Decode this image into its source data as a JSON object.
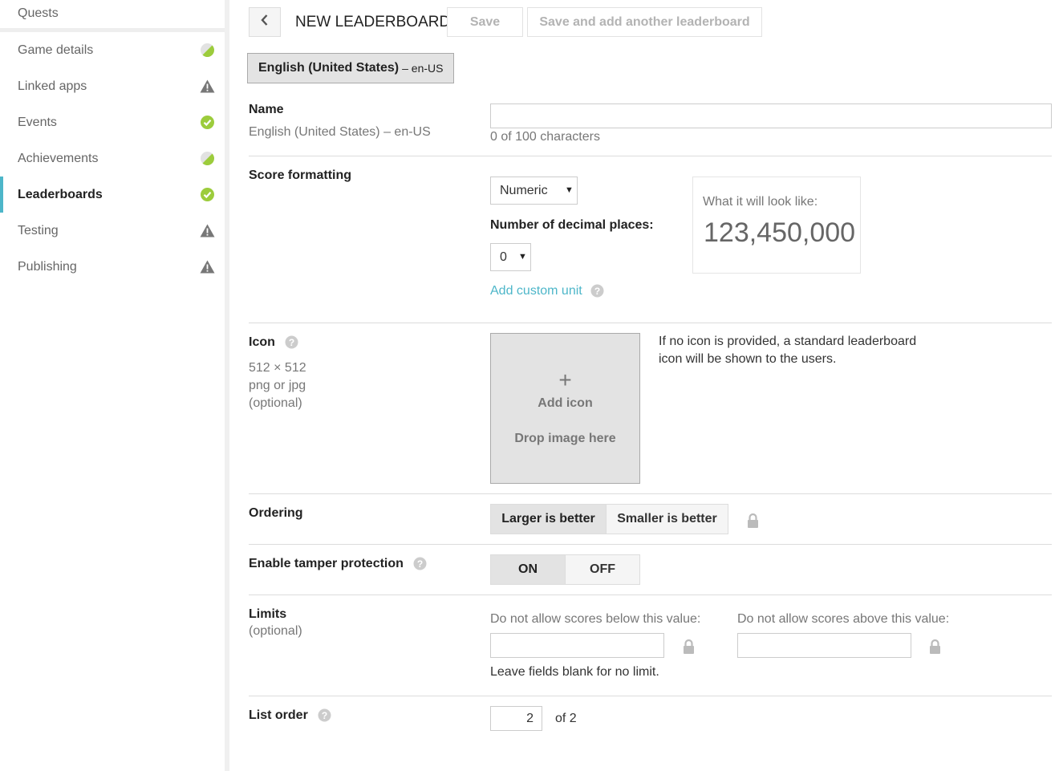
{
  "sidebar": {
    "top_item": "Quests",
    "items": [
      {
        "label": "Game details",
        "status": "partial"
      },
      {
        "label": "Linked apps",
        "status": "warning"
      },
      {
        "label": "Events",
        "status": "complete"
      },
      {
        "label": "Achievements",
        "status": "partial"
      },
      {
        "label": "Leaderboards",
        "status": "complete",
        "active": true
      },
      {
        "label": "Testing",
        "status": "warning"
      },
      {
        "label": "Publishing",
        "status": "warning"
      }
    ]
  },
  "header": {
    "title": "NEW LEADERBOARD",
    "save_label": "Save",
    "save_add_label": "Save and add another leaderboard"
  },
  "language_tab": {
    "name": "English (United States)",
    "code": "– en-US"
  },
  "name_section": {
    "label": "Name",
    "sublabel": "English (United States) – en-US",
    "value": "",
    "char_count": "0 of 100 characters"
  },
  "score_formatting": {
    "label": "Score formatting",
    "format_selected": "Numeric",
    "decimal_label": "Number of decimal places:",
    "decimal_selected": "0",
    "custom_unit_link": "Add custom unit",
    "preview_label": "What it will look like:",
    "preview_value": "123,450,000"
  },
  "icon_section": {
    "label": "Icon",
    "size": "512 × 512",
    "format": "png or jpg",
    "optional": "(optional)",
    "plus": "+",
    "add_icon": "Add icon",
    "drop_text": "Drop image here",
    "info": "If no icon is provided, a standard leaderboard icon will be shown to the users."
  },
  "ordering": {
    "label": "Ordering",
    "larger": "Larger is better",
    "smaller": "Smaller is better",
    "selected": "larger"
  },
  "tamper": {
    "label": "Enable tamper protection",
    "on": "ON",
    "off": "OFF",
    "selected": "on"
  },
  "limits": {
    "label": "Limits",
    "optional": "(optional)",
    "below_label": "Do not allow scores below this value:",
    "above_label": "Do not allow scores above this value:",
    "below_value": "",
    "above_value": "",
    "hint": "Leave fields blank for no limit."
  },
  "list_order": {
    "label": "List order",
    "value": "2",
    "of_text": "of 2"
  },
  "colors": {
    "accent": "#4db6c9",
    "complete": "#9ccc3c",
    "warning": "#777777"
  }
}
